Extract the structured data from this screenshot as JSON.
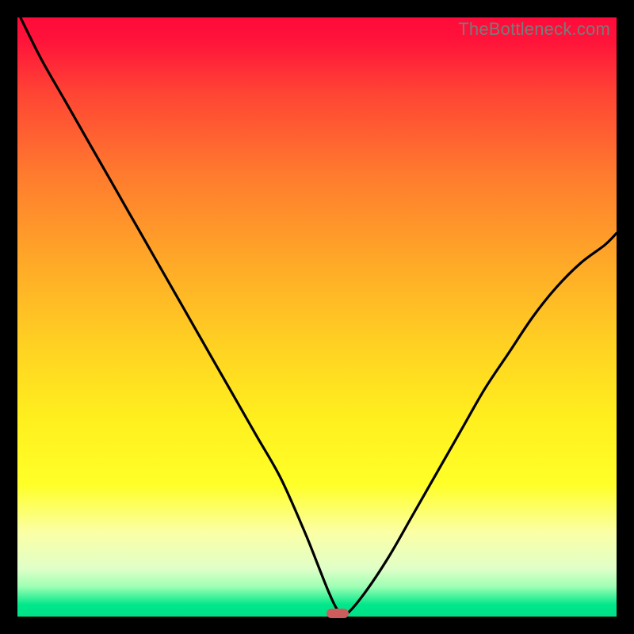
{
  "watermark": "TheBottleneck.com",
  "colors": {
    "frame": "#000000",
    "curve": "#000000",
    "marker": "#cd5c5c"
  },
  "chart_data": {
    "type": "line",
    "title": "",
    "xlabel": "",
    "ylabel": "",
    "xlim": [
      0,
      100
    ],
    "ylim": [
      0,
      100
    ],
    "grid": false,
    "legend": false,
    "background_gradient": {
      "direction": "vertical",
      "stops": [
        {
          "pos": 0.0,
          "color": "#ff0a3a"
        },
        {
          "pos": 0.26,
          "color": "#ff7a2e"
        },
        {
          "pos": 0.55,
          "color": "#ffd222"
        },
        {
          "pos": 0.78,
          "color": "#ffff28"
        },
        {
          "pos": 0.92,
          "color": "#e0ffc8"
        },
        {
          "pos": 1.0,
          "color": "#00e088"
        }
      ]
    },
    "series": [
      {
        "name": "bottleneck-curve",
        "x": [
          0.5,
          4,
          8,
          12,
          16,
          20,
          24,
          28,
          32,
          36,
          40,
          44,
          48,
          50,
          52,
          53.5,
          55,
          58,
          62,
          66,
          70,
          74,
          78,
          82,
          86,
          90,
          94,
          98,
          100
        ],
        "y": [
          100,
          93,
          86,
          79,
          72,
          65,
          58,
          51,
          44,
          37,
          30,
          23,
          14,
          9,
          4,
          1,
          0.5,
          4,
          10,
          17,
          24,
          31,
          38,
          44,
          50,
          55,
          59,
          62,
          64
        ]
      }
    ],
    "marker": {
      "x": 53.5,
      "y": 0.5,
      "shape": "pill",
      "color": "#cd5c5c"
    }
  }
}
